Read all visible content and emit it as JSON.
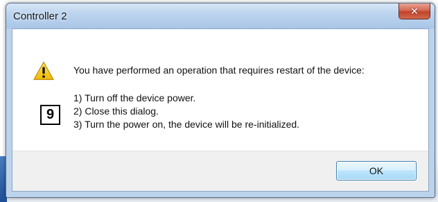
{
  "window": {
    "title": "Controller 2"
  },
  "dialog": {
    "icon": "warning-icon",
    "message": "You have performed an operation that requires restart of the device:",
    "steps": [
      "1) Turn off the device power.",
      "2) Close this dialog.",
      "3) Turn the power on, the device will be re-initialized."
    ],
    "badge": "9",
    "ok_label": "OK"
  },
  "colors": {
    "warning": "#f5c400",
    "close_button": "#c8452c",
    "ok_border": "#3c7fb1"
  }
}
